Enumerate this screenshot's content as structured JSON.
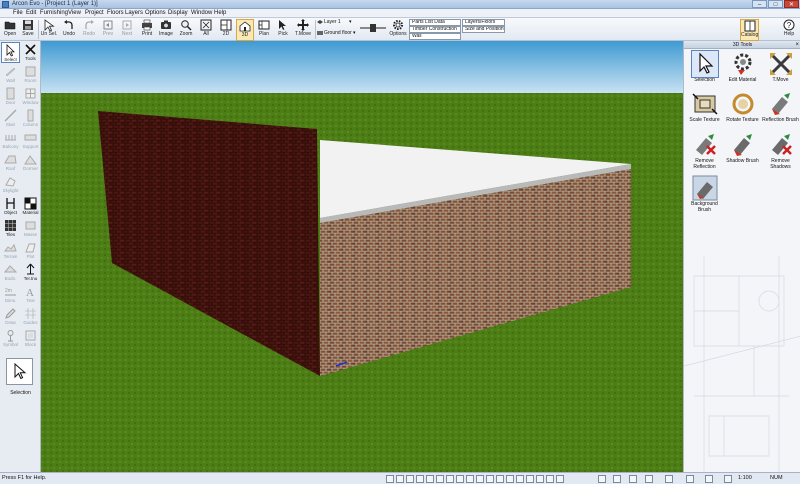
{
  "window": {
    "title": "Arcon Evo - [Project 1 (Layer 1)]",
    "buttons": [
      "–",
      "□",
      "✕"
    ]
  },
  "menu": [
    "File",
    "Edit",
    "Furnishing",
    "View",
    "Project",
    "Floors",
    "Layers",
    "Options",
    "Display",
    "Window",
    "Help"
  ],
  "toolbar": {
    "open": "Open",
    "save": "Save",
    "un_sel": "Un Sel.",
    "undo": "Undo",
    "redo": "Redo",
    "prev": "Prev",
    "next": "Next",
    "print": "Print",
    "image": "Image",
    "zoom": "Zoom",
    "all": "All",
    "view_2d": "2D",
    "view_3d": "3D",
    "plan": "Plan",
    "pick": "Pick",
    "t_move": "T.Move",
    "layer": "Layer 1",
    "ground_floor": "Ground floor",
    "options": "Options",
    "info_boxes": [
      "Parts List Data",
      "Layers/Floors",
      "Timber Construction",
      "Size and Position",
      "Wall"
    ],
    "catalog": "Catalog",
    "help": "Help"
  },
  "left_tools": {
    "select": "Select",
    "tools": "Tools",
    "wall": "Wall",
    "room": "Room",
    "door": "Door",
    "window": "Window",
    "stair": "Stair",
    "column": "Column",
    "balcony": "Balcony",
    "support": "Support",
    "roof": "Roof",
    "dormer": "Dormer",
    "skylight": "Skylight",
    "object": "Object",
    "material": "Material",
    "tiles": "Tiles",
    "mass": "Masse",
    "terrain": "Terrain",
    "plot": "Plot",
    "bodies": "Bodn.",
    "ter_tnu": "Ter.tnu",
    "dims": "Dims.",
    "text": "Text",
    "draw": "Draw",
    "guides": "Guides",
    "symbol": "Symbol",
    "block": "Block",
    "current_tool": "Selection"
  },
  "panel": {
    "title": "3D Tools",
    "tools": [
      {
        "label": "Selection",
        "icon": "cursor-icon"
      },
      {
        "label": "Edit Material",
        "icon": "gear-paint-icon"
      },
      {
        "label": "T.Move",
        "icon": "move-arrows-icon"
      },
      {
        "label": "Scale Texture",
        "icon": "scale-texture-icon"
      },
      {
        "label": "Rotate Texture",
        "icon": "rotate-texture-icon"
      },
      {
        "label": "Reflection Brush",
        "icon": "reflection-brush-icon"
      },
      {
        "label": "Remove Reflection",
        "icon": "remove-reflection-icon"
      },
      {
        "label": "Shadow Brush",
        "icon": "shadow-brush-icon"
      },
      {
        "label": "Remove Shadows",
        "icon": "remove-shadows-icon"
      },
      {
        "label": "Background Brush",
        "icon": "background-brush-icon"
      }
    ]
  },
  "status": {
    "help": "Press F1 for Help.",
    "scale": "1:100",
    "num": "NUM"
  },
  "colors": {
    "sky_top": "#3f9ad2",
    "sky_bottom": "#c8e2f3",
    "grass": "#4d7d15",
    "brick_dark": "#4a1510",
    "brick_light": "#7a4c34",
    "slab": "#f2f2f2"
  }
}
